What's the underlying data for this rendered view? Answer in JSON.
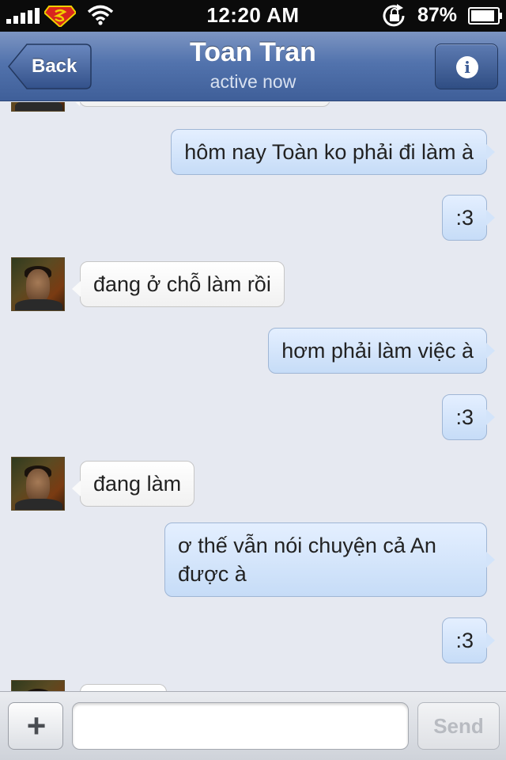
{
  "status_bar": {
    "time": "12:20 AM",
    "battery": "87%",
    "icons": [
      "signal-bars-icon",
      "carrier-superman-icon",
      "wifi-icon",
      "rotation-lock-icon",
      "battery-icon"
    ]
  },
  "nav": {
    "back_label": "Back",
    "title": "Toan Tran",
    "subtitle": "active now",
    "info_icon": "info-icon",
    "info_glyph": "i"
  },
  "thread": {
    "messages": [
      {
        "from": "me",
        "text": "hôm nay Toàn ko phải đi làm à"
      },
      {
        "from": "me",
        "text": ":3"
      },
      {
        "from": "them",
        "text": "đang ở chỗ làm rồi"
      },
      {
        "from": "me",
        "text": "hơm phải làm việc à"
      },
      {
        "from": "me",
        "text": ":3"
      },
      {
        "from": "them",
        "text": "đang làm"
      },
      {
        "from": "me",
        "text": "ơ thế vẫn nói chuyện cả An được à"
      },
      {
        "from": "me",
        "text": ":3"
      }
    ]
  },
  "composer": {
    "attach_glyph": "+",
    "input_value": "",
    "send_label": "Send"
  },
  "colors": {
    "nav_bar": "#4d6ea8",
    "outgoing_bubble": "#cfe2fa",
    "incoming_bubble": "#ffffff",
    "background": "#e6e9f1"
  }
}
